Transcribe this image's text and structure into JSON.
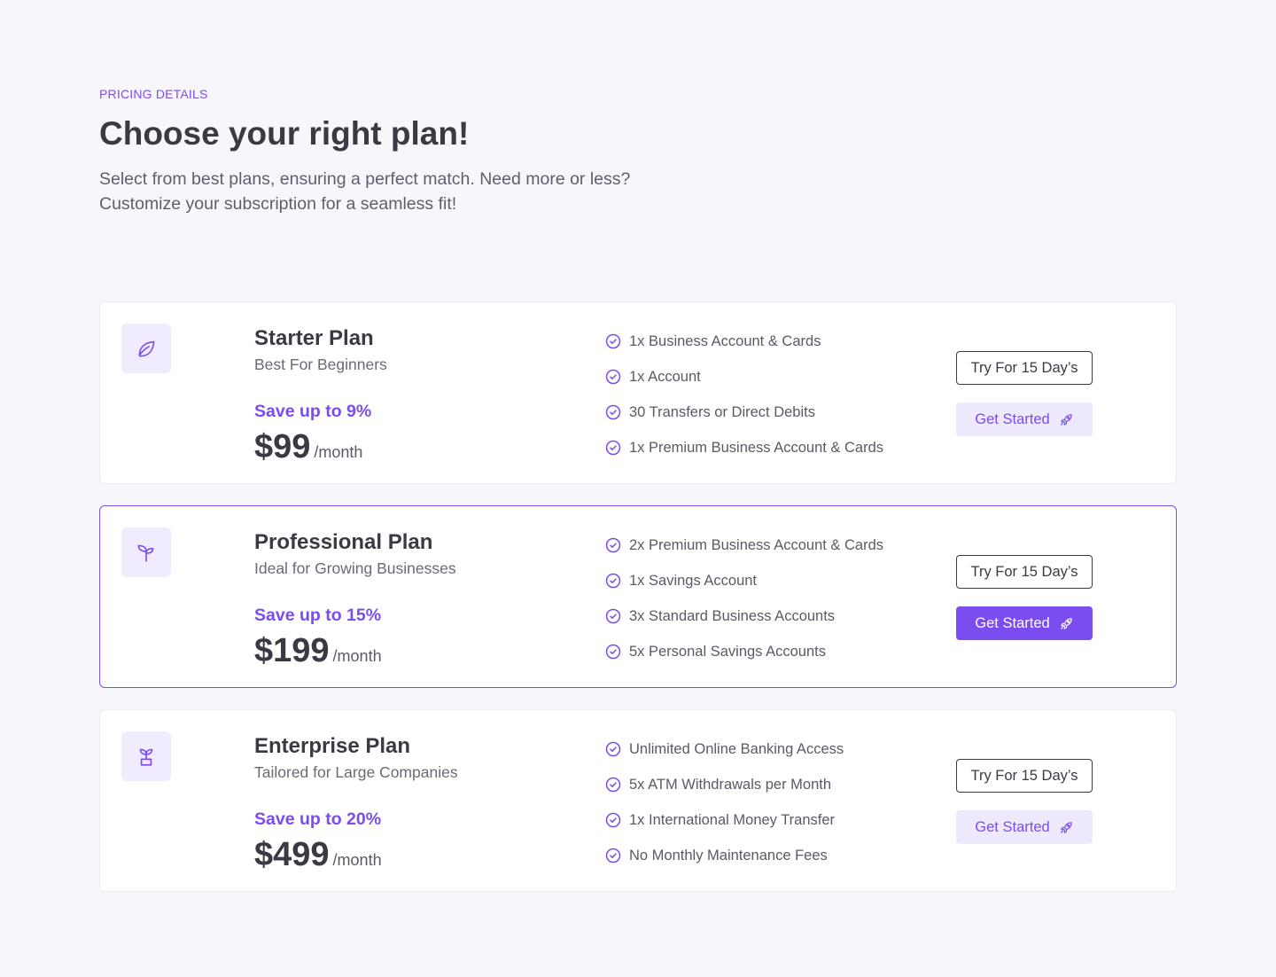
{
  "header": {
    "eyebrow": "PRICING DETAILS",
    "title": "Choose your right plan!",
    "subtitle_line1": "Select from best plans, ensuring a perfect match. Need more or less?",
    "subtitle_line2": "Customize your subscription for a seamless fit!"
  },
  "colors": {
    "accent": "#7b4cf0",
    "accent_light": "#efe9fe",
    "text_dark": "#3a3a44",
    "background": "#f7f7fb"
  },
  "plans": [
    {
      "icon": "leaf-icon",
      "name": "Starter Plan",
      "description": "Best For Beginners",
      "save": "Save up to 9%",
      "price": "$99",
      "period": "/month",
      "features": [
        "1x Business Account & Cards",
        "1x Account",
        "30 Transfers or Direct Debits",
        "1x Premium Business Account & Cards"
      ],
      "try_label": "Try For 15 Day’s",
      "start_label": "Get Started",
      "featured": false
    },
    {
      "icon": "sprout-icon",
      "name": "Professional Plan",
      "description": "Ideal for Growing Businesses",
      "save": "Save up to 15%",
      "price": "$199",
      "period": "/month",
      "features": [
        "2x Premium Business Account & Cards",
        "1x Savings Account",
        "3x Standard Business Accounts",
        "5x Personal Savings Accounts"
      ],
      "try_label": "Try For 15 Day’s",
      "start_label": "Get Started",
      "featured": true
    },
    {
      "icon": "potted-plant-icon",
      "name": "Enterprise Plan",
      "description": "Tailored for Large Companies",
      "save": "Save up to 20%",
      "price": "$499",
      "period": "/month",
      "features": [
        "Unlimited Online Banking Access",
        "5x ATM Withdrawals per Month",
        "1x International Money Transfer",
        "No Monthly Maintenance Fees"
      ],
      "try_label": "Try For 15 Day’s",
      "start_label": "Get Started",
      "featured": false
    }
  ]
}
